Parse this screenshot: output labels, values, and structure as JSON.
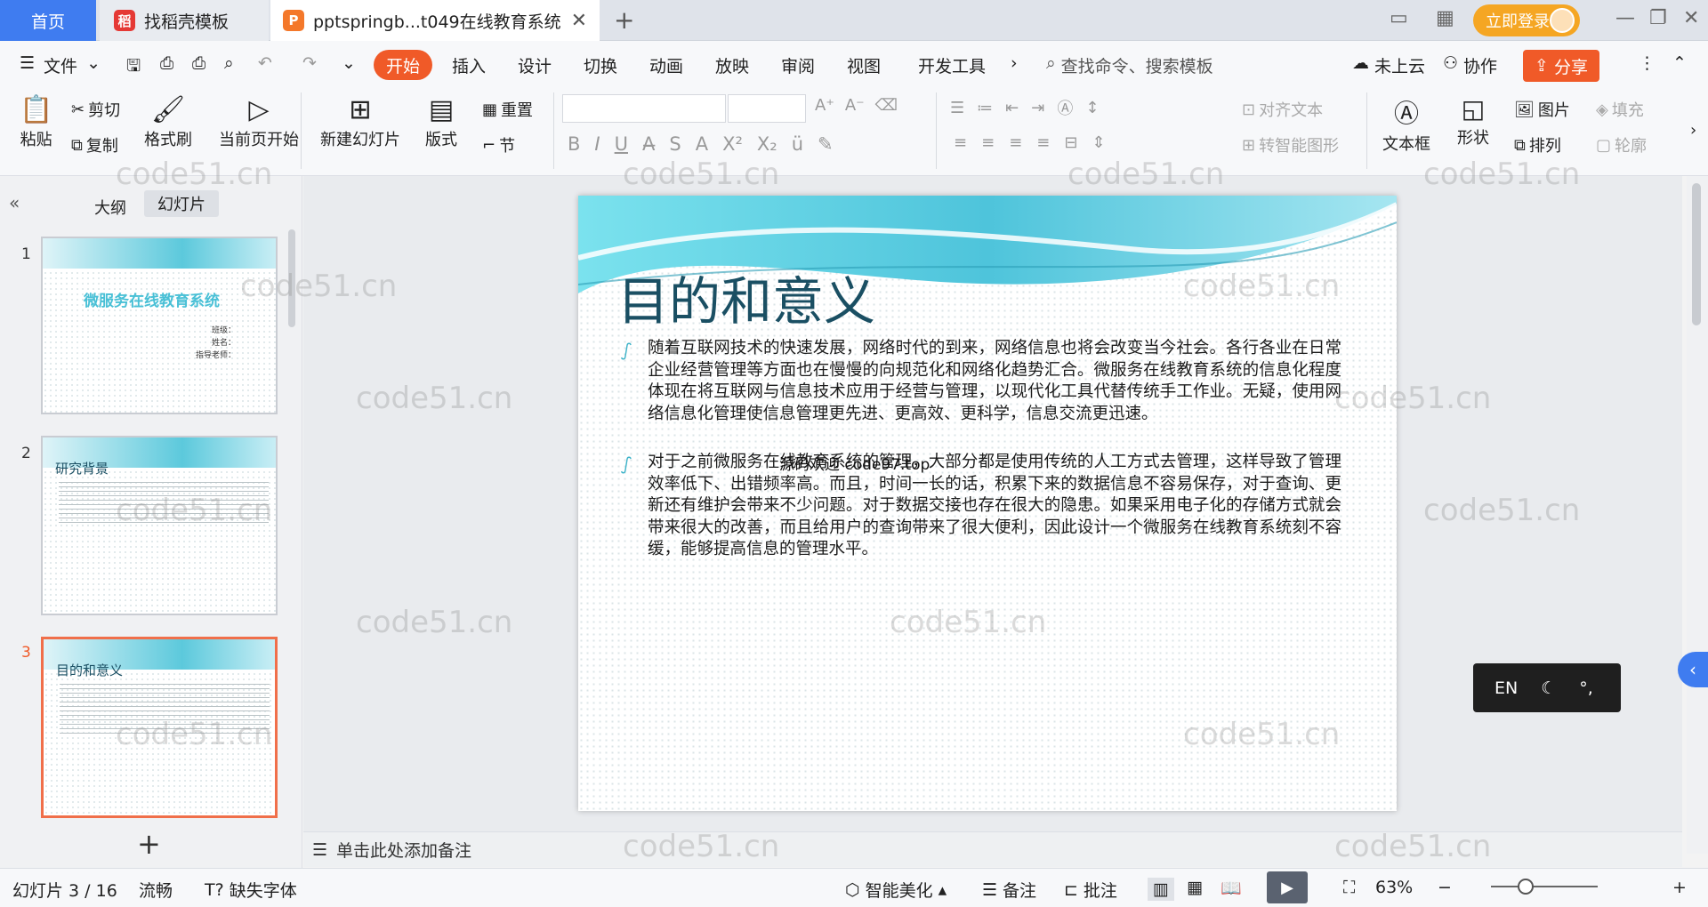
{
  "tabs": {
    "home": "首页",
    "template": "找稻壳模板",
    "doc": "pptspringb...t049在线教育系统",
    "login": "立即登录"
  },
  "menu": {
    "file": "文件",
    "items": [
      "开始",
      "插入",
      "设计",
      "切换",
      "动画",
      "放映",
      "审阅",
      "视图",
      "开发工具"
    ],
    "search": "查找命令、搜索模板",
    "cloud": "未上云",
    "collab": "协作",
    "share": "分享"
  },
  "ribbon": {
    "paste": "粘贴",
    "cut": "剪切",
    "copy": "复制",
    "format_painter": "格式刷",
    "from_current": "当前页开始",
    "new_slide": "新建幻灯片",
    "layout": "版式",
    "section": "节",
    "reset": "重置",
    "align_text": "对齐文本",
    "smart_art": "转智能图形",
    "text_box": "文本框",
    "shape": "形状",
    "picture": "图片",
    "arrange": "排列",
    "fill": "填充",
    "outline": "轮廓"
  },
  "left_panel": {
    "outline_tab": "大纲",
    "slides_tab": "幻灯片",
    "thumbs": [
      {
        "num": "1",
        "title": "微服务在线教育系统",
        "lines": [
          "班级：",
          "姓名：",
          "指导老师："
        ]
      },
      {
        "num": "2",
        "title": "研究背景"
      },
      {
        "num": "3",
        "title": "目的和意义"
      }
    ]
  },
  "slide": {
    "title": "目的和意义",
    "bullet1": "随着互联网技术的快速发展，网络时代的到来，网络信息也将会改变当今社会。各行各业在日常企业经营管理等方面也在慢慢的向规范化和网络化趋势汇合。微服务在线教育系统的信息化程度体现在将互联网与信息技术应用于经营与管理，以现代化工具代替传统手工作业。无疑，使用网络信息化管理使信息管理更先进、更高效、更科学，信息交流更迅速。",
    "bullet2": "对于之前微服务在线教育系统的管理，大部分都是使用传统的人工方式去管理，这样导致了管理效率低下、出错频率高。而且，时间一长的话，积累下来的数据信息不容易保存，对于查询、更新还有维护会带来不少问题。对于数据交接也存在很大的隐患。如果采用电子化的存储方式就会带来很大的改善，而且给用户的查询带来了很大便利，因此设计一个微服务在线教育系统刻不容缓，能够提高信息的管理水平。",
    "overlay": "源码欢迎 code97.top"
  },
  "notes": "单击此处添加备注",
  "ime": {
    "lang": "EN"
  },
  "status": {
    "slide_count": "幻灯片 3 / 16",
    "theme": "流畅",
    "missing_font": "缺失字体",
    "beautify": "智能美化",
    "notes": "备注",
    "comment": "批注",
    "zoom": "63%"
  },
  "watermark": "code51.cn"
}
